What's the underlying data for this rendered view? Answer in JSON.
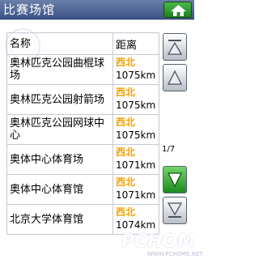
{
  "window": {
    "title": "比赛场馆"
  },
  "list": {
    "header": {
      "name": "名称",
      "distance": "距离"
    },
    "rows": [
      {
        "name": "奥林匹克公园曲棍球场",
        "direction": "西北",
        "distance": "1075km"
      },
      {
        "name": "奥林匹克公园射箭场",
        "direction": "西北",
        "distance": "1075km"
      },
      {
        "name": "奥林匹克公园网球中心",
        "direction": "西北",
        "distance": "1075km"
      },
      {
        "name": "奥体中心体育场",
        "direction": "西北",
        "distance": "1071km"
      },
      {
        "name": "奥体中心体育馆",
        "direction": "西北",
        "distance": "1071km"
      },
      {
        "name": "北京大学体育馆",
        "direction": "西北",
        "distance": "1074km"
      }
    ]
  },
  "pagination": {
    "indicator": "1/7"
  },
  "icons": {
    "home": "home-icon",
    "page_top": "arrow-up-bar-icon",
    "page_up": "arrow-up-icon",
    "page_down": "arrow-down-icon",
    "page_bottom": "arrow-down-bar-icon"
  },
  "colors": {
    "titlebar": "#4a5f92",
    "direction_text": "#f5a100",
    "home_button": "#2f9a2d",
    "down_button": "#2c9e29"
  },
  "watermark": {
    "brand": "PCHOME",
    "site": "WWW.PCHOME.NET"
  }
}
